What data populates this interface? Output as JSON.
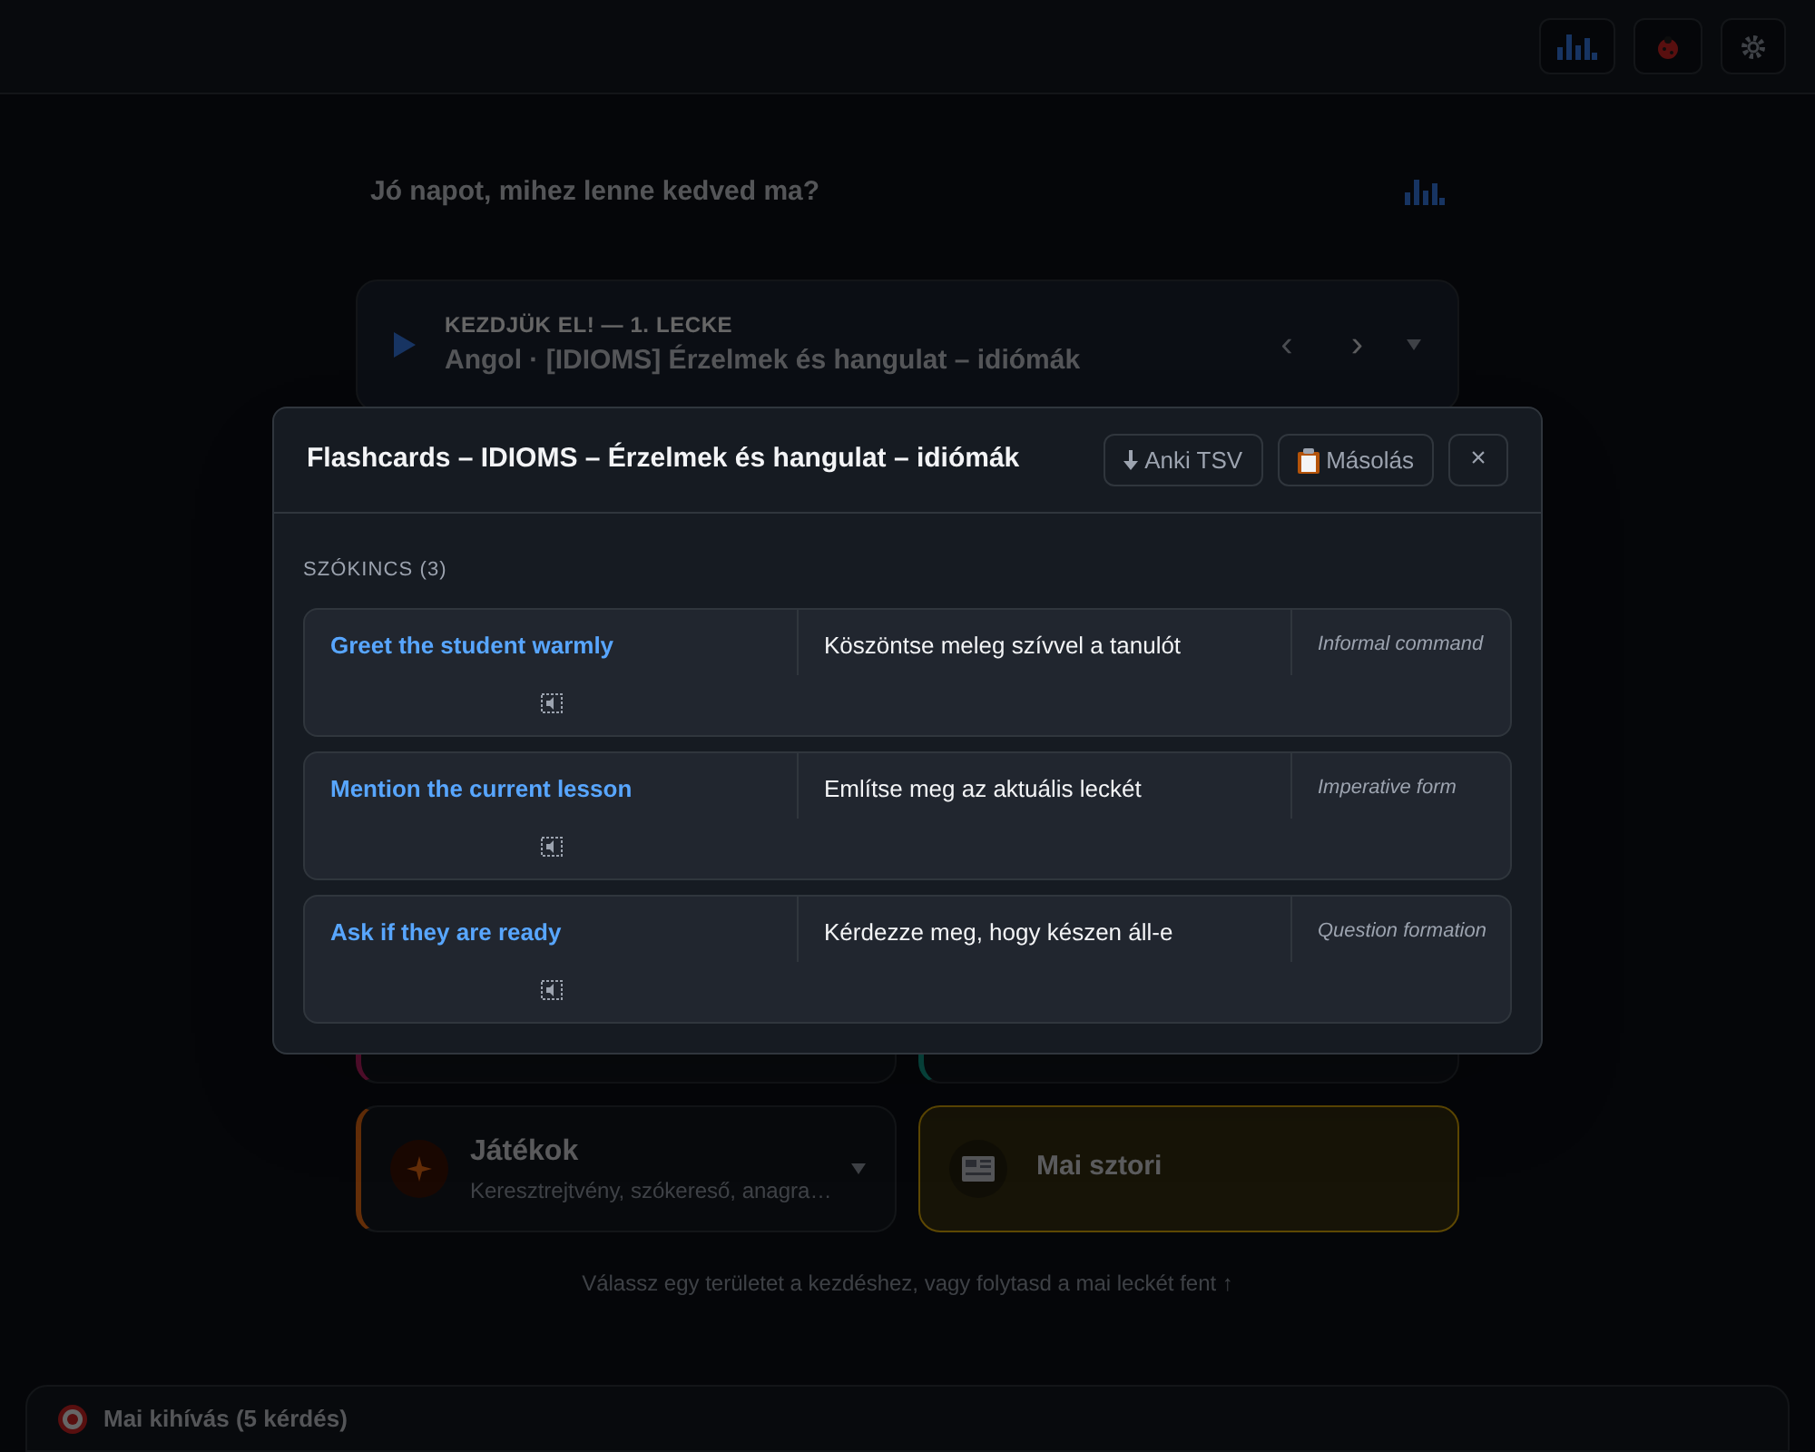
{
  "header": {
    "buttons": [
      {
        "kind": "stats"
      },
      {
        "kind": "bug"
      },
      {
        "kind": "settings"
      }
    ]
  },
  "greeting": "Jó napot, mihez lenne kedved ma?",
  "lesson": {
    "eyebrow": "KEZDJÜK EL! — 1. LECKE",
    "title": "Angol · [IDIOMS] Érzelmek és hangulat – idiómák",
    "previous": "‹",
    "next": "›"
  },
  "tiles": [
    {
      "kind": "lessons"
    },
    {
      "kind": "own"
    },
    {
      "kind": "games",
      "title": "Játékok",
      "subtitle": "Keresztrejtvény, szókereső, anagra…"
    },
    {
      "kind": "story",
      "title": "Mai sztori"
    }
  ],
  "hint": "Válassz egy területet a kezdéshez, vagy folytasd a mai leckét fent ↑",
  "challenge": "Mai kihívás (5 kérdés)",
  "modal": {
    "title": "Flashcards – IDIOMS – Érzelmek és hangulat – idiómák",
    "buttons": [
      {
        "kind": "download",
        "label": "Anki TSV"
      },
      {
        "kind": "copy",
        "label": "Másolás"
      },
      {
        "kind": "close",
        "label": "×"
      }
    ],
    "section": "SZÓKINCS (3)",
    "cards": [
      {
        "term": "Greet the student warmly",
        "translation": "Köszöntse meleg szívvel a tanulót",
        "note": "Informal command"
      },
      {
        "term": "Mention the current lesson",
        "translation": "Említse meg az aktuális leckét",
        "note": "Imperative form"
      },
      {
        "term": "Ask if they are ready",
        "translation": "Kérdezze meg, hogy készen áll-e",
        "note": "Question formation"
      }
    ]
  }
}
